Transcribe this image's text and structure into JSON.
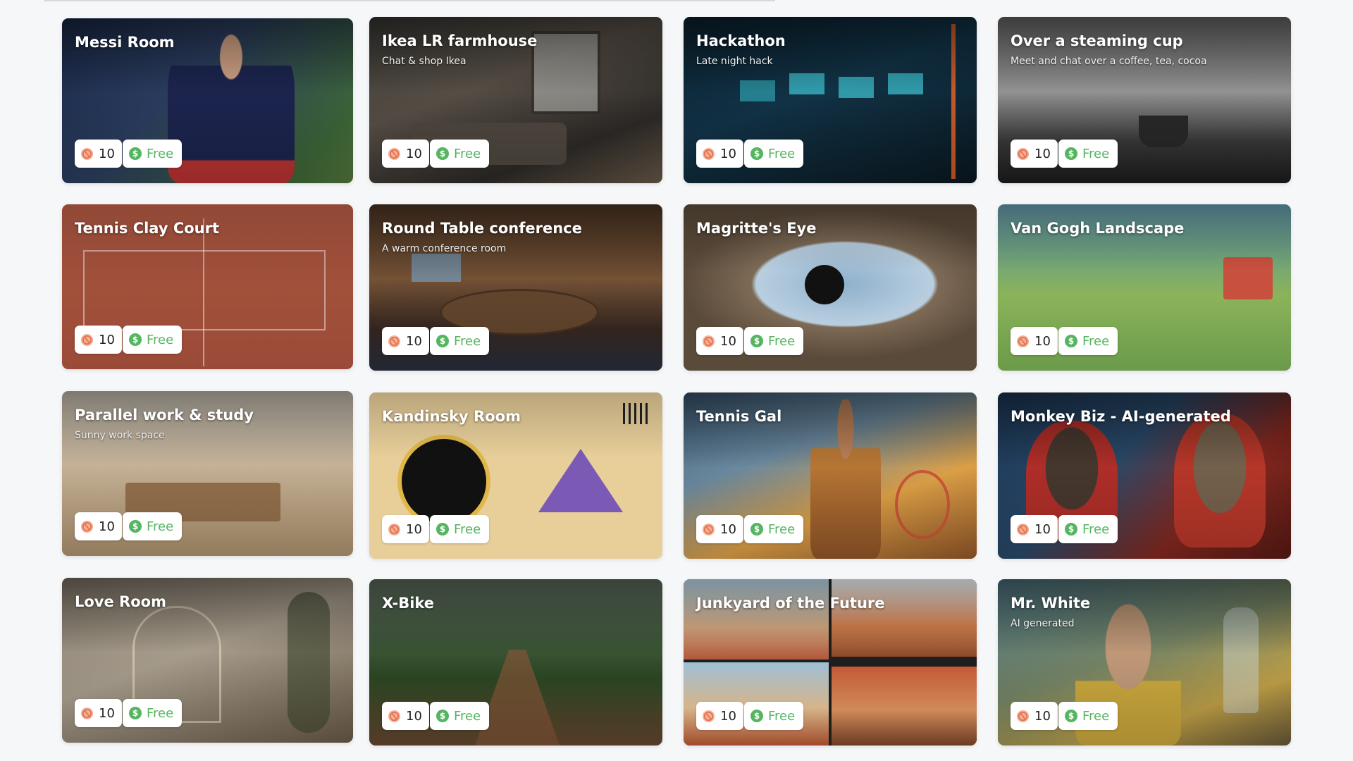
{
  "accent_green": "#56b560",
  "accent_orange": "#e8734f",
  "rooms": [
    {
      "title": "Messi Room",
      "subtitle": "",
      "count": "10",
      "price": "Free"
    },
    {
      "title": "Ikea LR farmhouse",
      "subtitle": "Chat & shop Ikea",
      "count": "10",
      "price": "Free"
    },
    {
      "title": "Hackathon",
      "subtitle": "Late night hack",
      "count": "10",
      "price": "Free"
    },
    {
      "title": "Over a steaming cup",
      "subtitle": "Meet and chat over a coffee, tea, cocoa",
      "count": "10",
      "price": "Free"
    },
    {
      "title": "Tennis Clay Court",
      "subtitle": "",
      "count": "10",
      "price": "Free"
    },
    {
      "title": "Round Table conference",
      "subtitle": "A warm conference room",
      "count": "10",
      "price": "Free"
    },
    {
      "title": "Magritte's Eye",
      "subtitle": "",
      "count": "10",
      "price": "Free"
    },
    {
      "title": "Van Gogh Landscape",
      "subtitle": "",
      "count": "10",
      "price": "Free"
    },
    {
      "title": "Parallel work & study",
      "subtitle": "Sunny work space",
      "count": "10",
      "price": "Free"
    },
    {
      "title": "Kandinsky Room",
      "subtitle": "",
      "count": "10",
      "price": "Free"
    },
    {
      "title": "Tennis Gal",
      "subtitle": "",
      "count": "10",
      "price": "Free"
    },
    {
      "title": "Monkey Biz - AI-generated",
      "subtitle": "",
      "count": "10",
      "price": "Free"
    },
    {
      "title": "Love Room",
      "subtitle": "",
      "count": "10",
      "price": "Free"
    },
    {
      "title": "X-Bike",
      "subtitle": "",
      "count": "10",
      "price": "Free"
    },
    {
      "title": "Junkyard of the Future",
      "subtitle": "",
      "count": "10",
      "price": "Free"
    },
    {
      "title": "Mr. White",
      "subtitle": "AI generated",
      "count": "10",
      "price": "Free"
    }
  ]
}
